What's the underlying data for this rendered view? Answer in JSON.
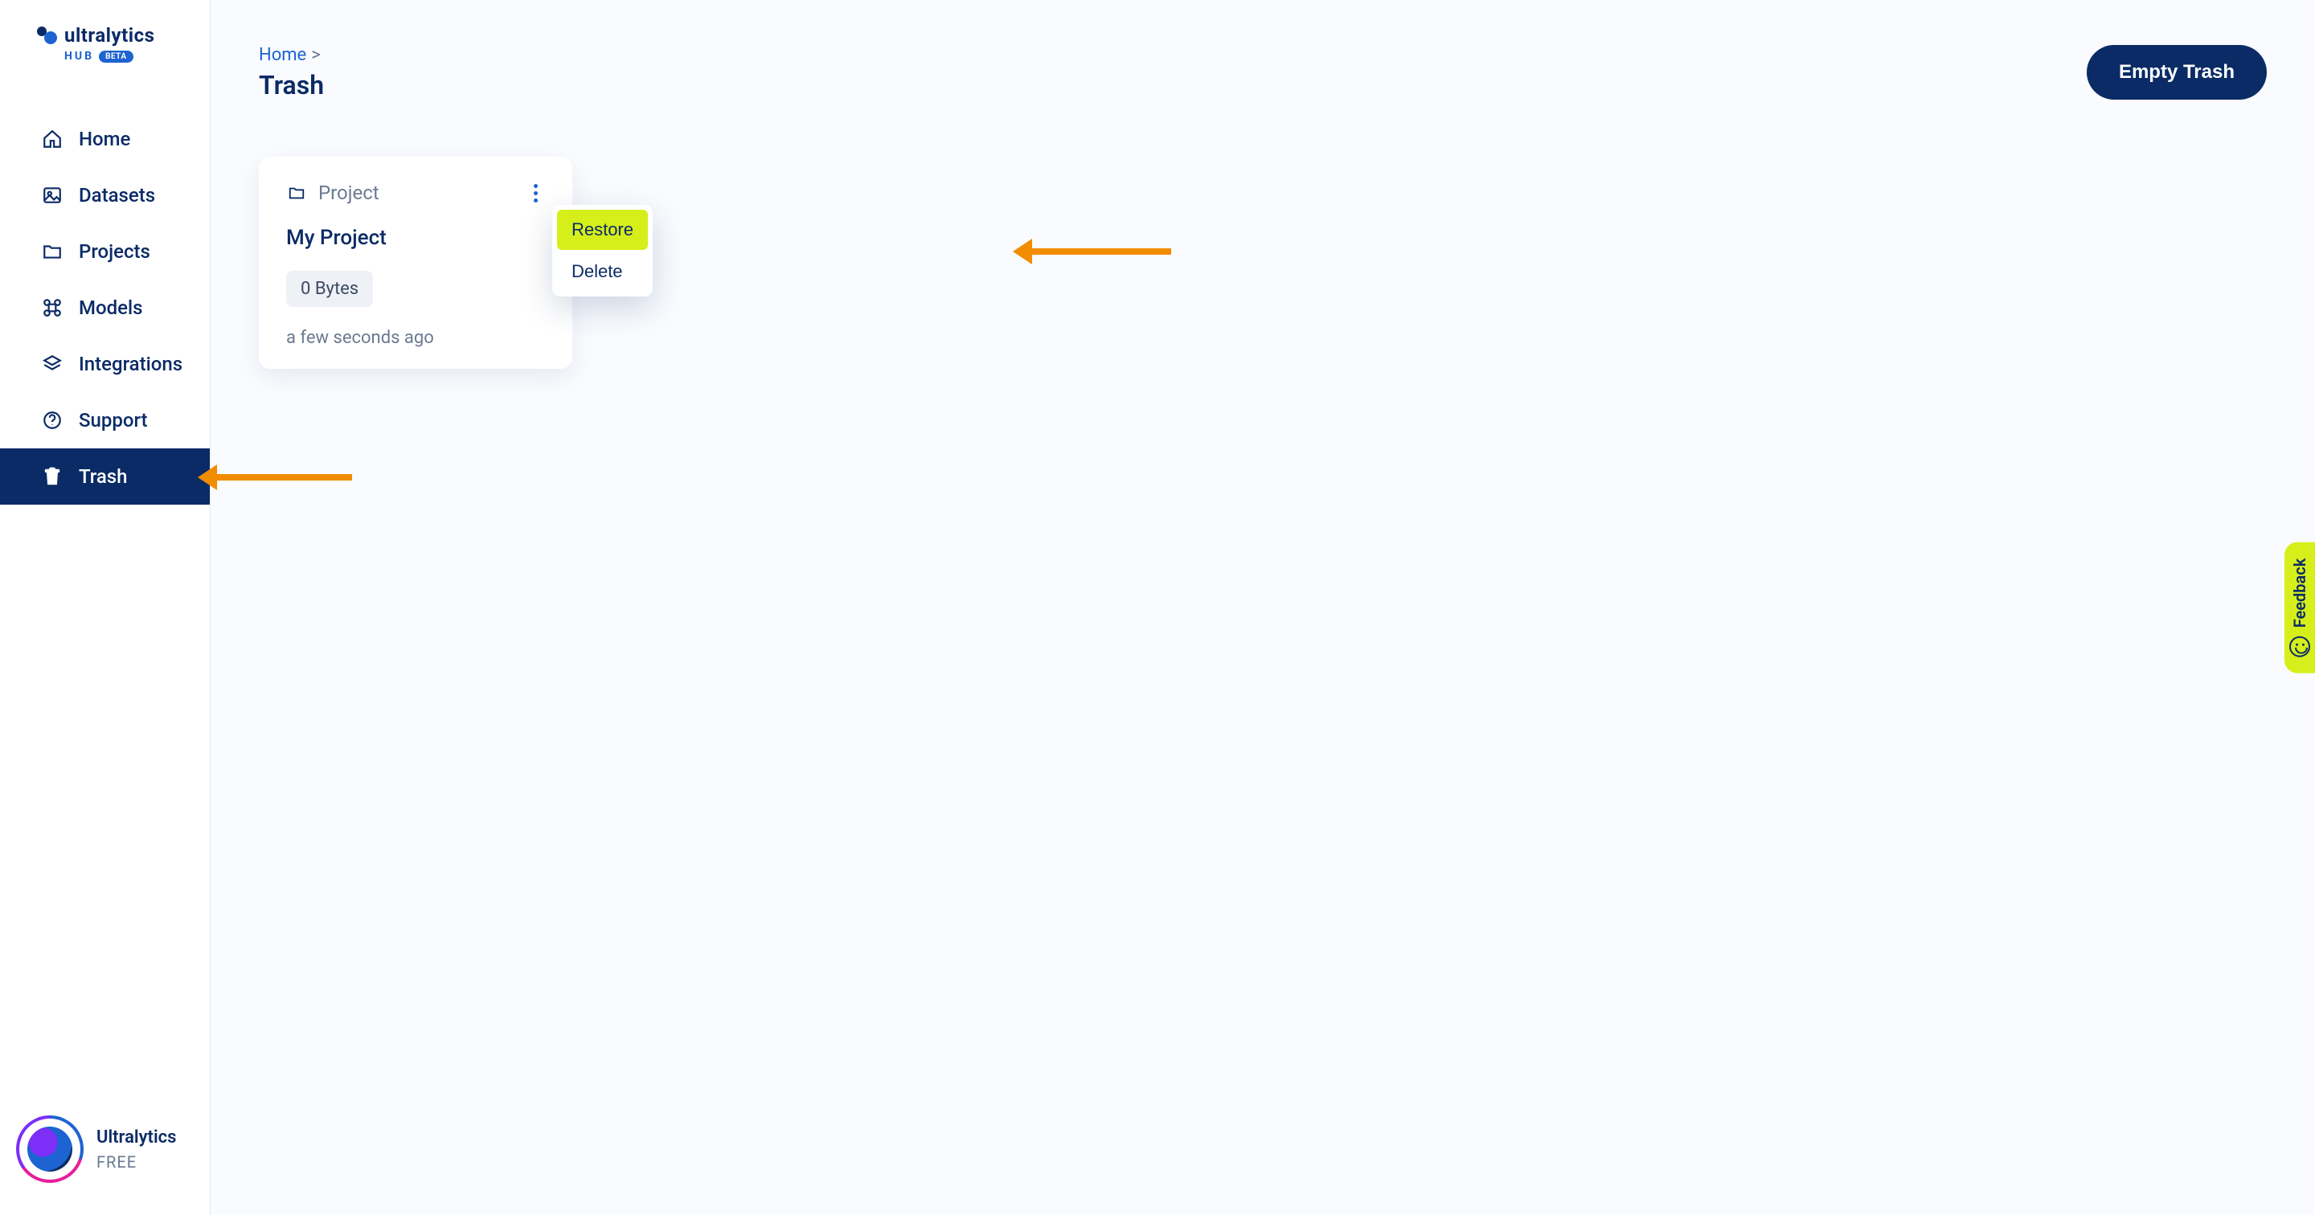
{
  "brand": {
    "name": "ultralytics",
    "sub": "HUB",
    "beta": "BETA"
  },
  "sidebar": {
    "items": [
      {
        "key": "home",
        "label": "Home"
      },
      {
        "key": "datasets",
        "label": "Datasets"
      },
      {
        "key": "projects",
        "label": "Projects"
      },
      {
        "key": "models",
        "label": "Models"
      },
      {
        "key": "integrations",
        "label": "Integrations"
      },
      {
        "key": "support",
        "label": "Support"
      },
      {
        "key": "trash",
        "label": "Trash"
      }
    ],
    "active": "trash",
    "footer": {
      "name": "Ultralytics",
      "tier": "FREE"
    }
  },
  "header": {
    "breadcrumb_home": "Home",
    "breadcrumb_sep": ">",
    "title": "Trash",
    "empty_trash": "Empty Trash"
  },
  "card": {
    "type": "Project",
    "name": "My Project",
    "size": "0 Bytes",
    "time": "a few seconds ago",
    "menu": {
      "restore": "Restore",
      "delete": "Delete"
    }
  },
  "feedback": {
    "label": "Feedback"
  },
  "colors": {
    "brand_dark": "#0b2b66",
    "brand_blue": "#1d63d1",
    "highlight": "#d6ef1a",
    "arrow": "#f28c00"
  }
}
